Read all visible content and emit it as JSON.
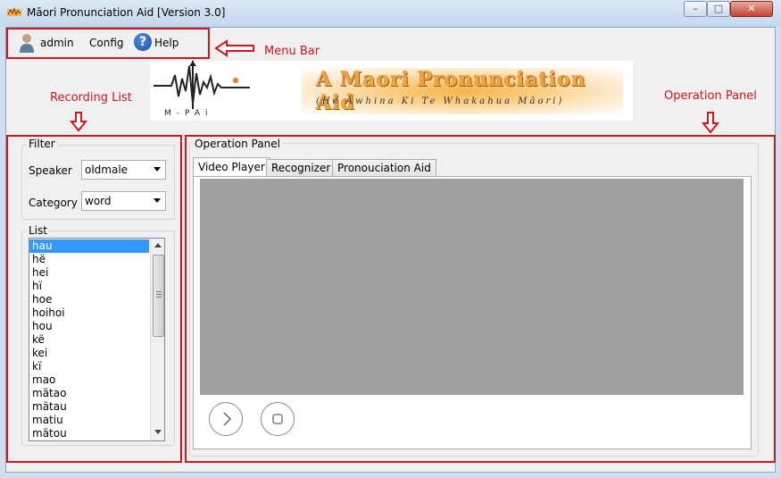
{
  "window": {
    "title": "Māori Pronunciation Aid [Version 3.0]",
    "controls": [
      "minimize",
      "maximize",
      "close"
    ]
  },
  "menubar": {
    "items": [
      {
        "label": "admin",
        "icon": "user-icon"
      },
      {
        "label": "Config"
      },
      {
        "label": "Help",
        "icon": "help-icon"
      }
    ]
  },
  "annotations": {
    "menu_bar": "Menu Bar",
    "recording_list": "Recording List",
    "operation_panel": "Operation Panel"
  },
  "banner": {
    "logo_text": "M-PAi",
    "title": "A Maori Pronunciation Aid",
    "subtitle": "(He Āwhina Ki Te Whakahua Māori)"
  },
  "filter": {
    "label": "Filter",
    "speaker_label": "Speaker",
    "speaker_value": "oldmale",
    "category_label": "Category",
    "category_value": "word"
  },
  "list": {
    "label": "List",
    "items": [
      "hau",
      "hë",
      "hei",
      "hï",
      "hoe",
      "hoihoi",
      "hou",
      "kë",
      "kei",
      "kï",
      "mao",
      "mätao",
      "mätau",
      "matiu",
      "mätou"
    ],
    "selected": "hau"
  },
  "operation_panel": {
    "label": "Operation Panel",
    "tabs": [
      "Video Player",
      "Recognizer",
      "Pronouciation Aid"
    ],
    "active_tab": "Video Player",
    "video_bg": "#a0a0a0",
    "buttons": [
      "play-icon",
      "stop-icon"
    ]
  },
  "colors": {
    "annotation_red": "#d0161c",
    "selection_blue": "#3399ff",
    "banner_orange": "#f3a33e"
  }
}
